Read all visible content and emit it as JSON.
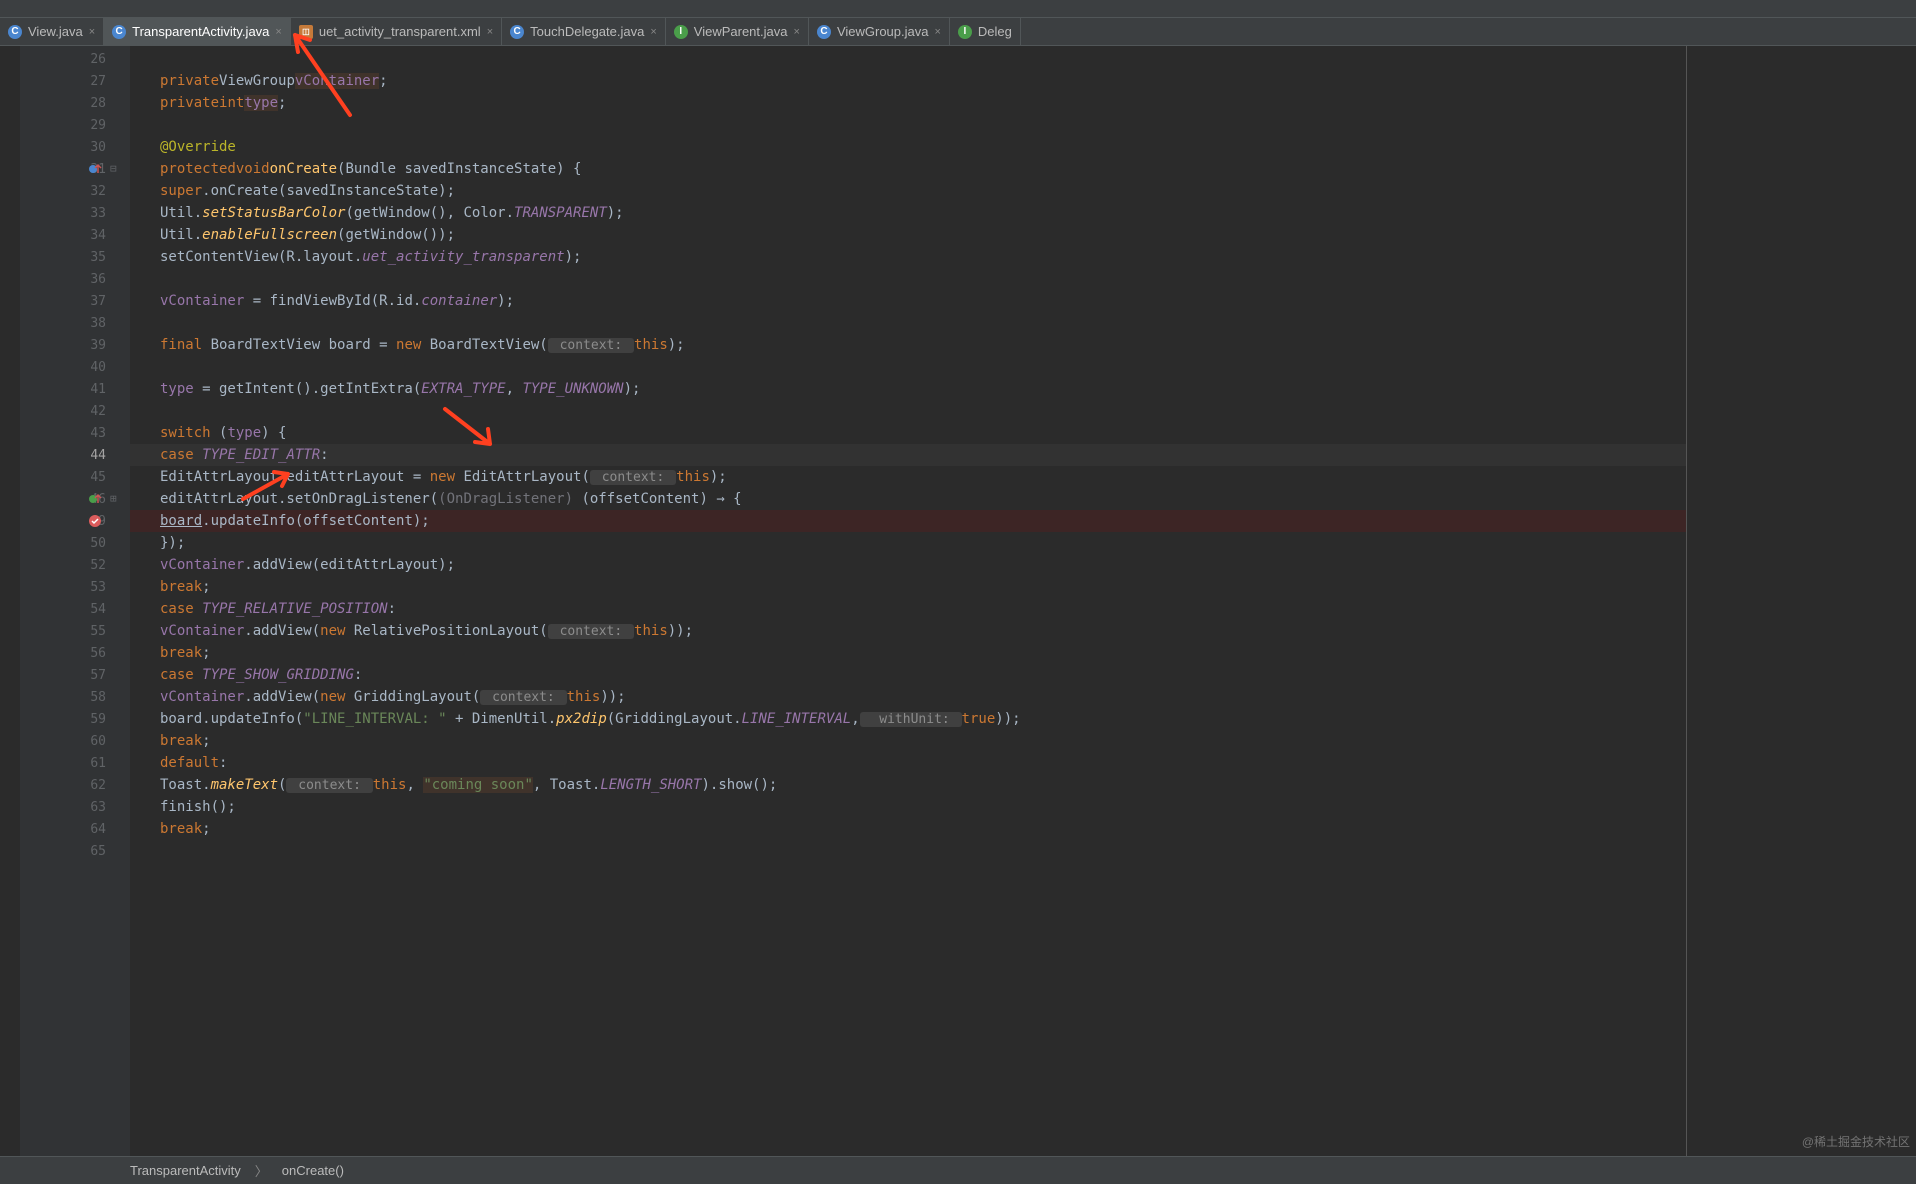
{
  "tabs": [
    {
      "label": "View.java",
      "icon": "c",
      "active": false,
      "closeable": true
    },
    {
      "label": "TransparentActivity.java",
      "icon": "c",
      "active": true,
      "closeable": true
    },
    {
      "label": "uet_activity_transparent.xml",
      "icon": "x",
      "active": false,
      "closeable": true
    },
    {
      "label": "TouchDelegate.java",
      "icon": "c",
      "active": false,
      "closeable": true
    },
    {
      "label": "ViewParent.java",
      "icon": "i",
      "active": false,
      "closeable": true
    },
    {
      "label": "ViewGroup.java",
      "icon": "c",
      "active": false,
      "closeable": true
    },
    {
      "label": "Deleg",
      "icon": "i",
      "active": false,
      "closeable": false
    }
  ],
  "gutter": {
    "lines": [
      "26",
      "27",
      "28",
      "29",
      "30",
      "31",
      "32",
      "33",
      "34",
      "35",
      "36",
      "37",
      "38",
      "39",
      "40",
      "41",
      "42",
      "43",
      "44",
      "45",
      "46",
      "49",
      "50",
      "52",
      "53",
      "54",
      "55",
      "56",
      "57",
      "58",
      "59",
      "60",
      "61",
      "62",
      "63",
      "64",
      "65"
    ],
    "current": "44",
    "marks": {
      "31": "override-arrow",
      "46": "green-arrow-fold",
      "49": "breakpoint"
    }
  },
  "breadcrumb": {
    "class": "TransparentActivity",
    "method": "onCreate()"
  },
  "watermark": "@稀土掘金技术社区",
  "code": {
    "line27": {
      "kw1": "private",
      "type": "ViewGroup",
      "field": "vContainer",
      "semi": ";"
    },
    "line28": {
      "kw1": "private",
      "kw2": "int",
      "field": "type",
      "semi": ";"
    },
    "line30": {
      "ann": "@Override"
    },
    "line31": {
      "kw1": "protected",
      "kw2": "void",
      "fn": "onCreate",
      "params": "(Bundle savedInstanceState) {"
    },
    "line32": {
      "kw": "super",
      "call": ".onCreate(savedInstanceState);"
    },
    "line33": {
      "cls": "Util.",
      "fn": "setStatusBarColor",
      "args": "(getWindow(), Color.",
      "const": "TRANSPARENT",
      "end": ");"
    },
    "line34": {
      "cls": "Util.",
      "fn": "enableFullscreen",
      "args": "(getWindow());"
    },
    "line35": {
      "call": "setContentView(R.layout.",
      "field": "uet_activity_transparent",
      "end": ");"
    },
    "line37": {
      "field": "vContainer",
      "call": " = findViewById(R.id.",
      "field2": "container",
      "end": ");"
    },
    "line39": {
      "kw1": "final ",
      "type": "BoardTextView board = ",
      "kw2": "new ",
      "call": "BoardTextView(",
      "param": " context: ",
      "kw3": "this",
      "end": ");"
    },
    "line41": {
      "field": "type",
      "call": " = getIntent().getIntExtra(",
      "const1": "EXTRA_TYPE",
      "sep": ", ",
      "const2": "TYPE_UNKNOWN",
      "end": ");"
    },
    "line43": {
      "kw": "switch ",
      "paren": "(",
      "field": "type",
      "end": ") {"
    },
    "line44": {
      "kw": "case ",
      "const": "TYPE_EDIT_ATTR",
      "end": ":"
    },
    "line45": {
      "type": "EditAttrLayout editAttrLayout = ",
      "kw": "new ",
      "call": "EditAttrLayout(",
      "param": " context: ",
      "kw2": "this",
      "end": ");"
    },
    "line46": {
      "call": "editAttrLayout.setOnDragListener(",
      "cast": "(OnDragListener) ",
      "lambda": "(offsetContent) → {"
    },
    "line49": {
      "call": "board",
      "method": ".updateInfo(offsetContent);"
    },
    "line50": {
      "end": "});"
    },
    "line52": {
      "field": "vContainer",
      "call": ".addView(editAttrLayout);"
    },
    "line53": {
      "kw": "break",
      "end": ";"
    },
    "line54": {
      "kw": "case ",
      "const": "TYPE_RELATIVE_POSITION",
      "end": ":"
    },
    "line55": {
      "field": "vContainer",
      "call": ".addView(",
      "kw": "new ",
      "type": "RelativePositionLayout(",
      "param": " context: ",
      "kw2": "this",
      "end": "));"
    },
    "line56": {
      "kw": "break",
      "end": ";"
    },
    "line57": {
      "kw": "case ",
      "const": "TYPE_SHOW_GRIDDING",
      "end": ":"
    },
    "line58": {
      "field": "vContainer",
      "call": ".addView(",
      "kw": "new ",
      "type": "GriddingLayout(",
      "param": " context: ",
      "kw2": "this",
      "end": "));"
    },
    "line59": {
      "call": "board.updateInfo(",
      "str": "\"LINE_INTERVAL: \"",
      "plus": " + DimenUtil.",
      "fn": "px2dip",
      "args": "(GriddingLayout.",
      "const": "LINE_INTERVAL",
      "sep": ",",
      "param2": "  withUnit: ",
      "kw2": "true",
      "end": "));"
    },
    "line60": {
      "kw": "break",
      "end": ";"
    },
    "line61": {
      "kw": "default",
      "end": ":"
    },
    "line62": {
      "cls": "Toast.",
      "fn": "makeText",
      "args": "(",
      "param": " context: ",
      "kw": "this",
      "sep": ", ",
      "str": "\"coming soon\"",
      "sep2": ", Toast.",
      "const": "LENGTH_SHORT",
      "end": ").show();"
    },
    "line63": {
      "call": "finish();"
    },
    "line64": {
      "kw": "break",
      "end": ";"
    }
  }
}
